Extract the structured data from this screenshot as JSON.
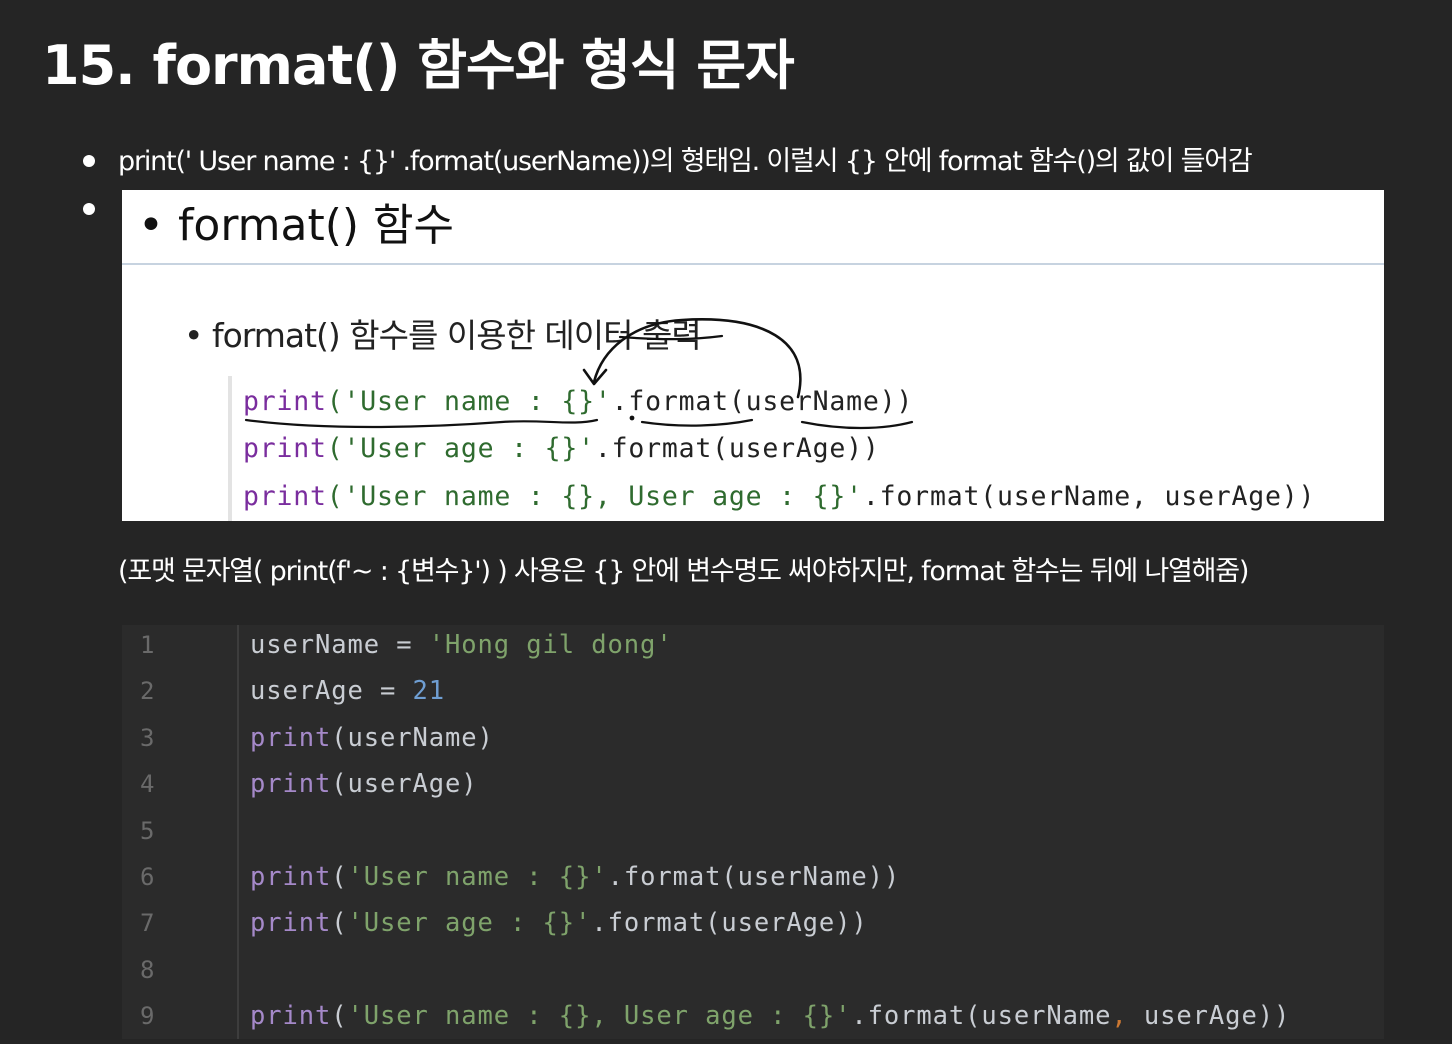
{
  "page": {
    "title": "15. format() 함수와 형식 문자"
  },
  "notes": {
    "bullet_1": "print(' User name : {}' .format(userName))의 형태임. 이럴시 {} 안에 format 함수()의 값이 들어감",
    "caption": "(포맷 문자열( print(f'~ : {변수}') ) 사용은 {} 안에 변수명도 써야하지만, format 함수는 뒤에 나열해줌)"
  },
  "slide": {
    "heading": "• format() 함수",
    "subheading": "• format() 함수를 이용한 데이터 출력",
    "code_lines": [
      [
        {
          "t": "print",
          "c": "s-kw"
        },
        {
          "t": "('User name : {}'",
          "c": "s-str"
        },
        {
          "t": ".format(userName))",
          "c": "s-id"
        }
      ],
      [
        {
          "t": "print",
          "c": "s-kw"
        },
        {
          "t": "('User age : {}'",
          "c": "s-str"
        },
        {
          "t": ".format(userAge))",
          "c": "s-id"
        }
      ],
      [
        {
          "t": "print",
          "c": "s-kw"
        },
        {
          "t": "('User name : {}, User age : {}'",
          "c": "s-str"
        },
        {
          "t": ".format(userName, userAge))",
          "c": "s-id"
        }
      ]
    ]
  },
  "editor": {
    "lines": [
      {
        "n": "1",
        "tokens": [
          {
            "t": "userName = ",
            "c": "t-plain"
          },
          {
            "t": "'Hong gil dong'",
            "c": "t-str"
          }
        ]
      },
      {
        "n": "2",
        "tokens": [
          {
            "t": "userAge = ",
            "c": "t-plain"
          },
          {
            "t": "21",
            "c": "t-num"
          }
        ]
      },
      {
        "n": "3",
        "tokens": [
          {
            "t": "print",
            "c": "t-kw"
          },
          {
            "t": "(userName)",
            "c": "t-plain"
          }
        ]
      },
      {
        "n": "4",
        "tokens": [
          {
            "t": "print",
            "c": "t-kw"
          },
          {
            "t": "(userAge)",
            "c": "t-plain"
          }
        ]
      },
      {
        "n": "5",
        "tokens": []
      },
      {
        "n": "6",
        "tokens": [
          {
            "t": "print",
            "c": "t-kw"
          },
          {
            "t": "(",
            "c": "t-plain"
          },
          {
            "t": "'User name : {}'",
            "c": "t-str"
          },
          {
            "t": ".format(userName))",
            "c": "t-plain"
          }
        ]
      },
      {
        "n": "7",
        "tokens": [
          {
            "t": "print",
            "c": "t-kw"
          },
          {
            "t": "(",
            "c": "t-plain"
          },
          {
            "t": "'User age : {}'",
            "c": "t-str"
          },
          {
            "t": ".format(userAge))",
            "c": "t-plain"
          }
        ]
      },
      {
        "n": "8",
        "tokens": []
      },
      {
        "n": "9",
        "tokens": [
          {
            "t": "print",
            "c": "t-kw"
          },
          {
            "t": "(",
            "c": "t-plain"
          },
          {
            "t": "'User name : {}, User age : {}'",
            "c": "t-str"
          },
          {
            "t": ".format(userName",
            "c": "t-plain"
          },
          {
            "t": ",",
            "c": "t-punc"
          },
          {
            "t": " userAge))",
            "c": "t-plain"
          }
        ]
      }
    ]
  },
  "colors": {
    "background": "#252525",
    "editor_background": "#2b2b2b",
    "keyword": "#a589c9",
    "string": "#7fa36b",
    "number": "#6f9ed2"
  }
}
